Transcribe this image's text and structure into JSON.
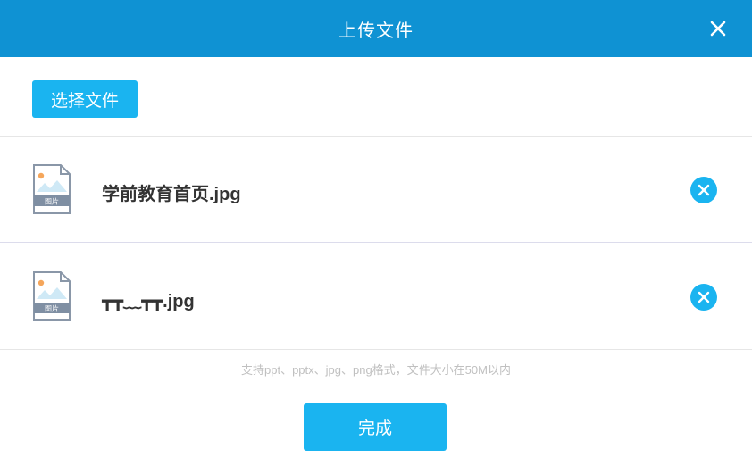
{
  "dialog": {
    "title": "上传文件",
    "close_icon": "close-icon"
  },
  "toolbar": {
    "choose_label": "选择文件"
  },
  "files": [
    {
      "name": "学前教育首页.jpg",
      "type_badge": "图片",
      "icon": "image-file-icon",
      "remove_icon": "remove-circle-icon"
    },
    {
      "name": "┳┳﹏┳┳.jpg",
      "type_badge": "图片",
      "icon": "image-file-icon",
      "remove_icon": "remove-circle-icon"
    }
  ],
  "hint": "支持ppt、pptx、jpg、png格式，文件大小在50M以内",
  "footer": {
    "done_label": "完成"
  },
  "colors": {
    "header_bg": "#0f92d3",
    "button_bg": "#1ab4f0",
    "remove_bg": "#1ab4f0"
  }
}
